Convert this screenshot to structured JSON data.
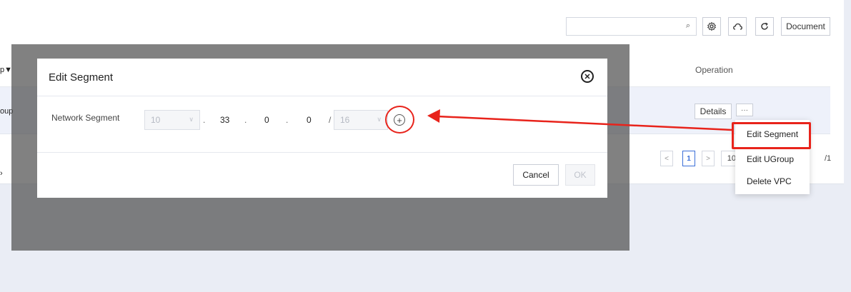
{
  "toolbar": {
    "search_placeholder": "",
    "search_icon": "search-icon",
    "icons": [
      "settings-icon",
      "cloud-icon",
      "refresh-icon"
    ],
    "document_label": "Document"
  },
  "table": {
    "operation_header": "Operation",
    "left_header_fragment": "p",
    "left_cell_fragment": "oup",
    "left_footer_fragment": "›",
    "row": {
      "details_label": "Details",
      "more_label": "···"
    }
  },
  "pager": {
    "prev": "<",
    "current": "1",
    "next": ">",
    "size": "10",
    "total": "/1"
  },
  "dropdown": {
    "items": [
      "Edit Segment",
      "Edit UGroup",
      "Delete VPC"
    ]
  },
  "modal": {
    "title": "Edit Segment",
    "field_label": "Network Segment",
    "octet1": "10",
    "octet2": "33",
    "octet3": "0",
    "octet4": "0",
    "dot": ".",
    "slash": "/",
    "prefix": "16",
    "cancel_label": "Cancel",
    "ok_label": "OK"
  },
  "annotation": {
    "highlight_color": "#e8231b"
  }
}
